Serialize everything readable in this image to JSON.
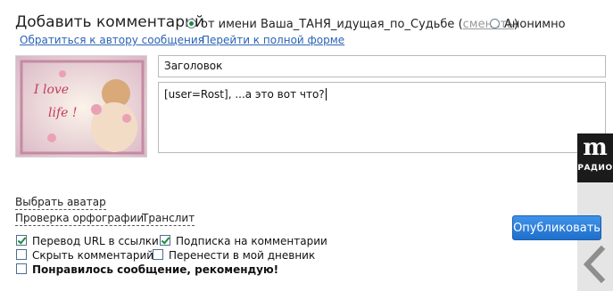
{
  "header": {
    "title": "Добавить комментарий",
    "option_named_prefix": "от имени Ваша_ТАНЯ_идущая_по_Судьбе (",
    "change_link": "сменить",
    "option_named_suffix": ")",
    "option_anonymous": "Анонимно"
  },
  "links": {
    "contact_author": "Обратиться к автору сообщения",
    "full_form": "Перейти к полной форме"
  },
  "avatar": {
    "line1": "I love",
    "line2": "life !"
  },
  "form": {
    "subject_value": "Заголовок",
    "body_value": "[user=Rost], ...а это вот что?"
  },
  "tools": {
    "choose_avatar": "Выбрать аватар",
    "spellcheck": "Проверка орфографии",
    "translit": "Транслит"
  },
  "options": {
    "url_to_links": "Перевод URL в ссылки",
    "subscribe": "Подписка на комментарии",
    "hide_comment": "Скрыть комментарий",
    "move_to_diary": "Перенести в мой дневник",
    "recommend": "Понравилось сообщение, рекомендую!"
  },
  "publish_label": "Опубликовать",
  "side": {
    "logo_letter": "m",
    "radio_label": "РАДИО"
  },
  "colors": {
    "link": "#2b63b5",
    "button": "#2a7fd9",
    "check": "#1f8a3b"
  }
}
